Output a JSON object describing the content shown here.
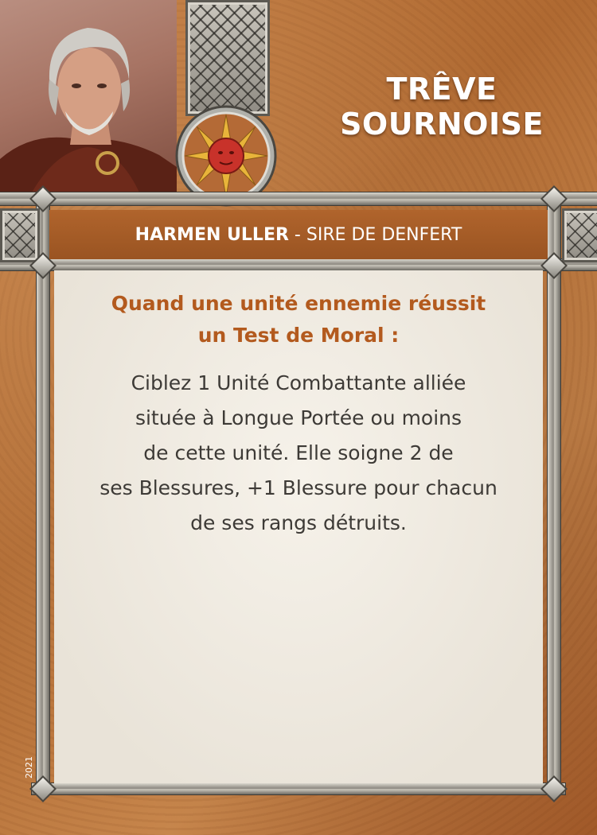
{
  "card": {
    "title_line1": "TRÊVE",
    "title_line2": "SOURNOISE",
    "commander_name": "HARMEN ULLER",
    "commander_separator": " - ",
    "commander_title": "SIRE DE DENFERT",
    "trigger_line1": "Quand une unité ennemie réussit",
    "trigger_line2": "un Test de Moral :",
    "effect_lines": [
      "Ciblez 1 Unité Combattante alliée",
      "située à Longue Portée ou moins",
      "de cette unité. Elle soigne 2 de",
      "ses Blessures, +1 Blessure pour chacun",
      "de ses rangs détruits."
    ],
    "year": "2021"
  },
  "icons": {
    "faction": "sun-face-icon",
    "portrait": "commander-portrait"
  },
  "colors": {
    "card_background": "#b8703a",
    "banner": "#a35b26",
    "trigger_text": "#b35a1e",
    "effect_text": "#3d3a36",
    "panel": "#f2eee6",
    "frame": "#8c8880",
    "sun_gold": "#e8b43a",
    "sun_face": "#c8322a"
  }
}
